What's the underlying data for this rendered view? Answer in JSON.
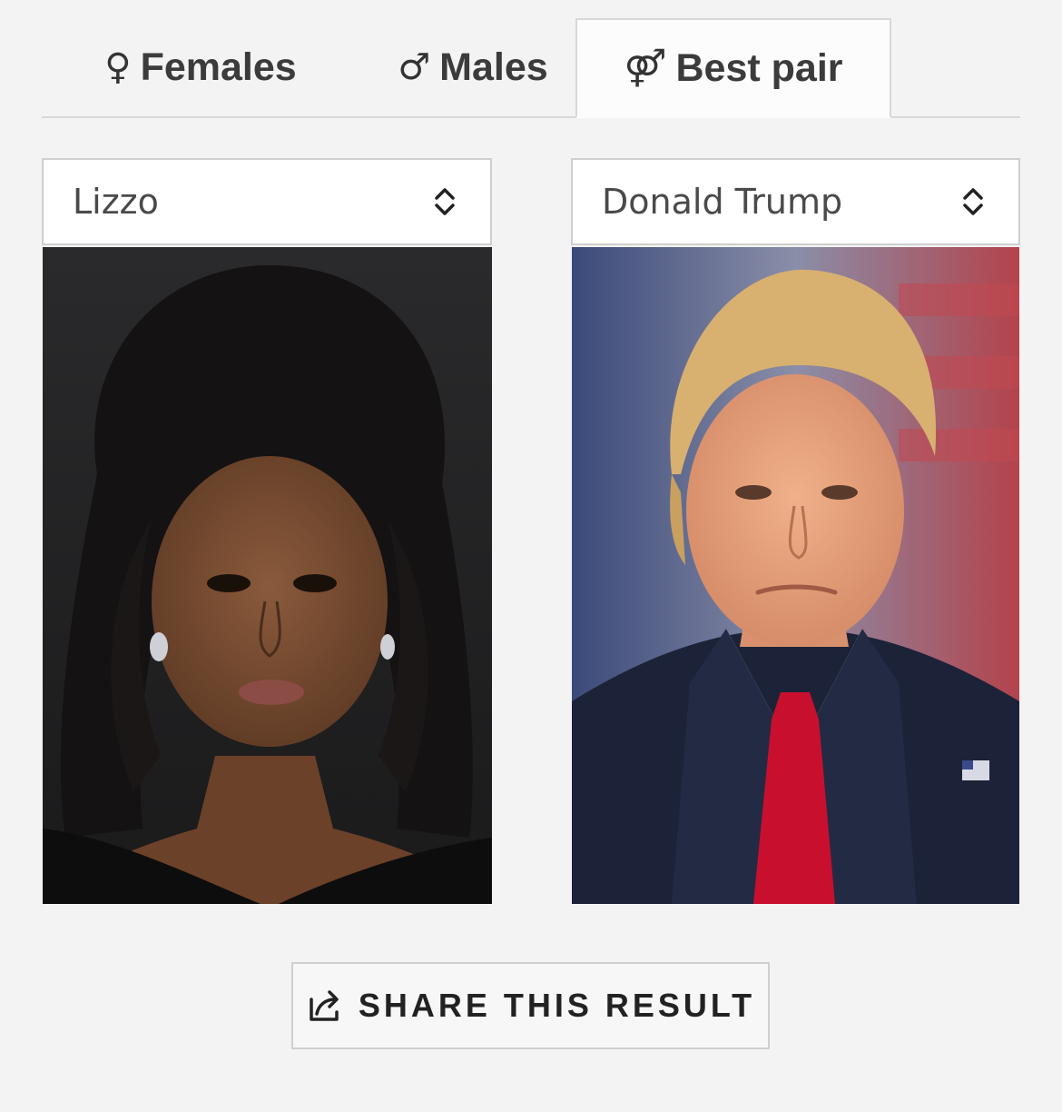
{
  "tabs": [
    {
      "symbol": "♀",
      "label": "Females",
      "active": false
    },
    {
      "symbol": "♂",
      "label": "Males",
      "active": false
    },
    {
      "symbol": "⚤",
      "label": "Best pair",
      "active": true
    }
  ],
  "selects": {
    "left": {
      "value": "Lizzo"
    },
    "right": {
      "value": "Donald Trump"
    }
  },
  "photos": {
    "left": {
      "icon": "portrait-photo"
    },
    "right": {
      "icon": "portrait-photo"
    }
  },
  "share": {
    "label": "SHARE THIS RESULT",
    "icon": "share-icon"
  },
  "colors": {
    "background": "#f3f3f3",
    "border": "#cfcfcf",
    "text": "#333333",
    "tie_red": "#c8102e",
    "suit_navy": "#1c2238"
  }
}
